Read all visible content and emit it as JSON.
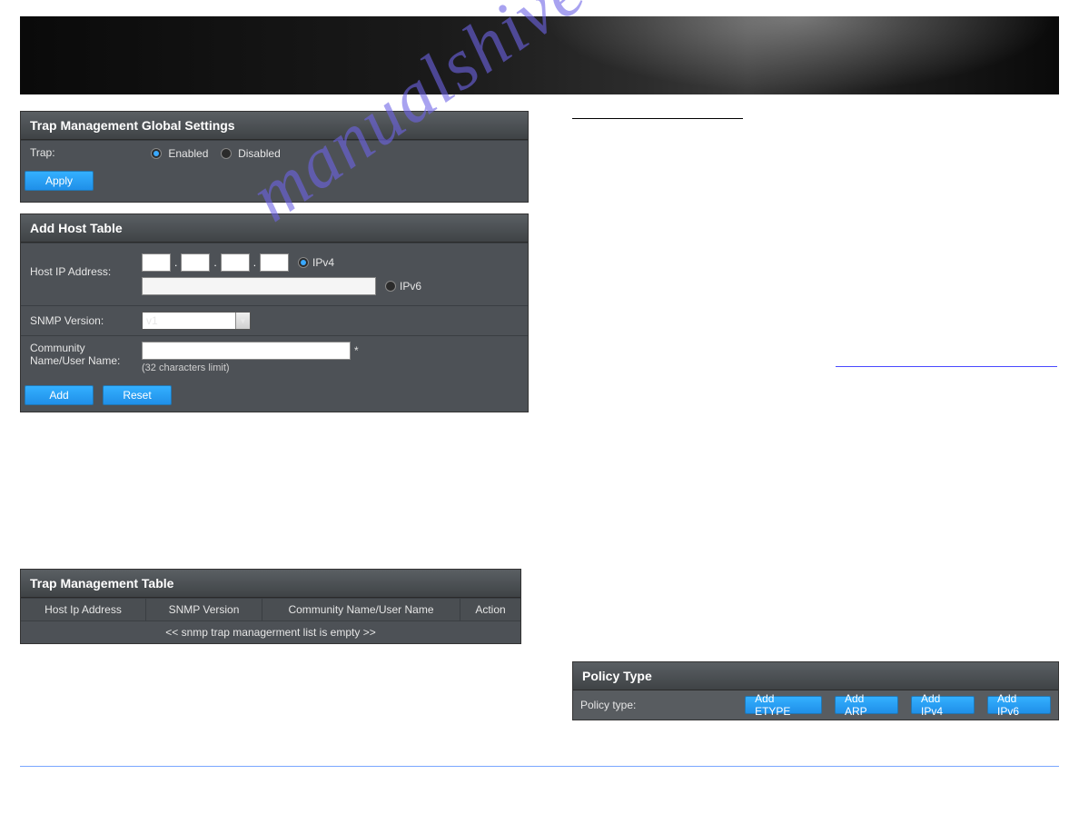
{
  "watermark": "manualshive.com",
  "global": {
    "title": "Trap Management Global Settings",
    "trap_label": "Trap:",
    "enabled": "Enabled",
    "disabled": "Disabled",
    "apply": "Apply"
  },
  "addHost": {
    "title": "Add Host Table",
    "host_ip_label": "Host IP Address:",
    "ipv4": "IPv4",
    "ipv6": "IPv6",
    "snmp_label": "SNMP Version:",
    "snmp_value": "v1",
    "community_label1": "Community",
    "community_label2": "Name/User Name:",
    "limit_hint": "(32 characters limit)",
    "add": "Add",
    "reset": "Reset"
  },
  "trapTable": {
    "title": "Trap Management Table",
    "cols": {
      "c1": "Host Ip Address",
      "c2": "SNMP Version",
      "c3": "Community Name/User Name",
      "c4": "Action"
    },
    "empty": "<< snmp trap managerment list is empty >>"
  },
  "policy": {
    "title": "Policy Type",
    "label": "Policy type:",
    "b1": "Add ETYPE",
    "b2": "Add ARP",
    "b3": "Add IPv4",
    "b4": "Add IPv6"
  }
}
